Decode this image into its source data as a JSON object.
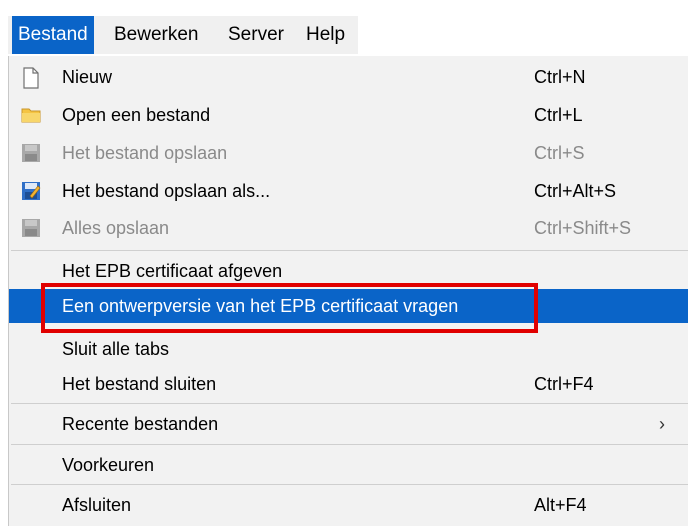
{
  "menubar": {
    "items": [
      "Bestand",
      "Bewerken",
      "Server",
      "Help"
    ]
  },
  "menu": {
    "items": [
      {
        "label": "Nieuw",
        "shortcut": "Ctrl+N",
        "icon": "document-icon"
      },
      {
        "label": "Open een bestand",
        "shortcut": "Ctrl+L",
        "icon": "folder-icon"
      },
      {
        "label": "Het bestand opslaan",
        "shortcut": "Ctrl+S",
        "icon": "save-icon",
        "disabled": true
      },
      {
        "label": "Het bestand opslaan als...",
        "shortcut": "Ctrl+Alt+S",
        "icon": "save-as-icon"
      },
      {
        "label": "Alles opslaan",
        "shortcut": "Ctrl+Shift+S",
        "icon": "save-all-icon",
        "disabled": true
      },
      {
        "label": "Het EPB certificaat afgeven",
        "shortcut": ""
      },
      {
        "label": "Een ontwerpversie van het EPB certificaat vragen",
        "shortcut": "",
        "selected": true
      },
      {
        "label": "Sluit alle tabs",
        "shortcut": ""
      },
      {
        "label": "Het bestand sluiten",
        "shortcut": "Ctrl+F4"
      },
      {
        "label": "Recente bestanden",
        "shortcut": "",
        "submenu": true
      },
      {
        "label": "Voorkeuren",
        "shortcut": ""
      },
      {
        "label": "Afsluiten",
        "shortcut": "Alt+F4"
      }
    ]
  },
  "colors": {
    "selection": "#0a64c8",
    "highlight_border": "#e00000",
    "disabled_text": "#8a8a8a",
    "menu_background": "#f2f2f2"
  }
}
